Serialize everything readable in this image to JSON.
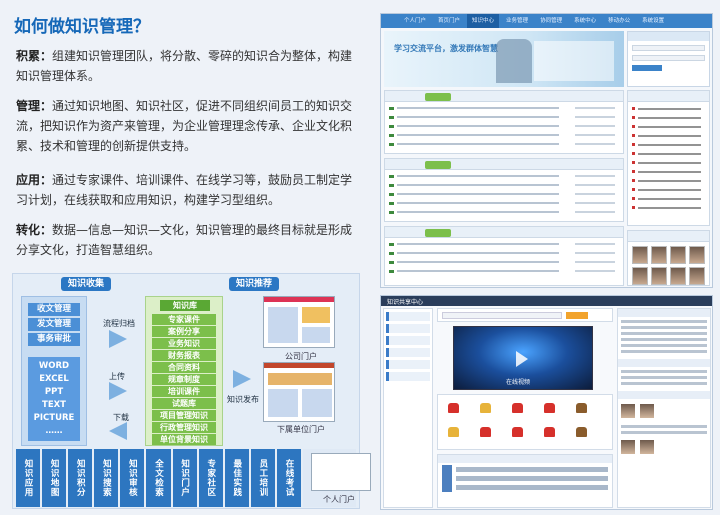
{
  "title": "如何做知识管理？",
  "sections": [
    {
      "term": "积累：",
      "text": "组建知识管理团队，将分散、零碎的知识合为整体，构建知识管理体系。"
    },
    {
      "term": "管理：",
      "text": "通过知识地图、知识社区，促进不同组织间员工的知识交流，把知识作为资产来管理，为企业管理理念传承、企业文化积累、技术和管理的创新提供支持。"
    },
    {
      "term": "应用：",
      "text": "通过专家课件、培训课件、在线学习等，鼓励员工制定学习计划，在线获取和应用知识，构建学习型组织。"
    },
    {
      "term": "转化：",
      "text": "数据—信息—知识—文化，知识管理的最终目标就是形成分享文化，打造智慧组织。"
    }
  ],
  "diagram": {
    "tab_collect": "知识收集",
    "tab_recommend": "知识推荐",
    "left_buttons": [
      "收文管理",
      "发文管理",
      "事务审批"
    ],
    "doc_types": [
      "WORD",
      "EXCEL",
      "PPT",
      "TEXT",
      "PICTURE",
      "……"
    ],
    "arrow_labels": {
      "archive": "流程归档",
      "upload": "上传",
      "download": "下载",
      "publish": "知识发布"
    },
    "library_title": "知识库",
    "library_items": [
      "专家课件",
      "案例分享",
      "业务知识",
      "财务报表",
      "合同资料",
      "规章制度",
      "培训课件",
      "试题库",
      "项目管理知识",
      "行政管理知识",
      "单位背景知识"
    ],
    "thumb_captions": [
      "公司门户",
      "下属单位门户",
      "个人门户"
    ],
    "bottom_cells": [
      "知识应用",
      "知识地图",
      "知识积分",
      "知识搜索",
      "知识审核",
      "全文检索",
      "知识门户",
      "专家社区",
      "最佳实践",
      "员工培训",
      "在线考试"
    ]
  },
  "shot1": {
    "nav": [
      "个人门户",
      "首页门户",
      "知识中心",
      "业务管理",
      "协同管理",
      "系统中心",
      "移动办公",
      "系统设置"
    ],
    "banner_text": "学习交流平台，激发群体智慧"
  },
  "shot2": {
    "header": "知识共享中心",
    "video_caption": "在线视频"
  }
}
